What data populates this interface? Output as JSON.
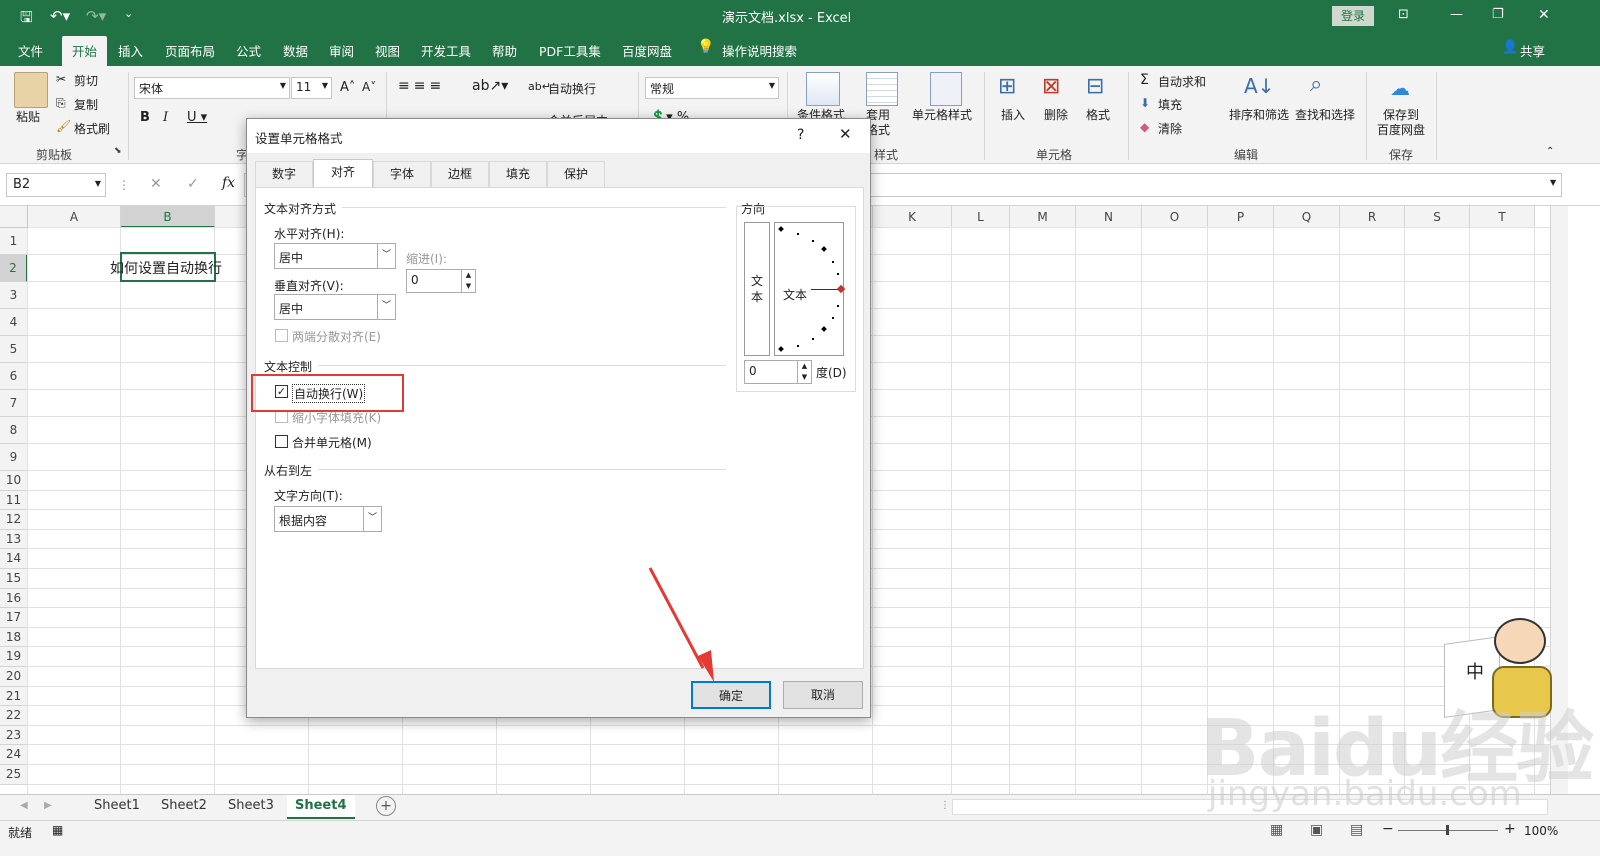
{
  "window": {
    "title": "演示文档.xlsx  -  Excel",
    "login": "登录",
    "share": "共享"
  },
  "ribbon_tabs": [
    "文件",
    "开始",
    "插入",
    "页面布局",
    "公式",
    "数据",
    "审阅",
    "视图",
    "开发工具",
    "帮助",
    "PDF工具集",
    "百度网盘",
    "操作说明搜索"
  ],
  "ribbon": {
    "paste": "粘贴",
    "cut": "剪切",
    "copy": "复制",
    "format_painter": "格式刷",
    "clipboard_group": "剪贴板",
    "font_name": "宋体",
    "font_size": "11",
    "font_group_partial": "字",
    "wrap_text": "自动换行",
    "merge_center": "合并后居中",
    "number_format": "常规",
    "conditional_format": "条件格式",
    "table_format_1": "套用",
    "table_format_2": "格式",
    "cell_styles": "单元格样式",
    "styles_group": "样式",
    "insert": "插入",
    "delete": "删除",
    "format": "格式",
    "cells_group": "单元格",
    "autosum": "自动求和",
    "fill": "填充",
    "clear": "清除",
    "sort_filter": "排序和筛选",
    "find_select": "查找和选择",
    "editing_group": "编辑",
    "save_to_1": "保存到",
    "save_to_2": "百度网盘",
    "save_group": "保存"
  },
  "formula_bar": {
    "name_box": "B2",
    "fx": "fx",
    "value": ""
  },
  "grid": {
    "columns": [
      "A",
      "B",
      "",
      "",
      "",
      "",
      "",
      "",
      "",
      "K",
      "L",
      "M",
      "N",
      "O",
      "P",
      "Q",
      "R",
      "S",
      "T"
    ],
    "rows": [
      "1",
      "2",
      "3",
      "4",
      "5",
      "6",
      "7",
      "8",
      "9",
      "10",
      "11",
      "12",
      "13",
      "14",
      "15",
      "16",
      "17",
      "18",
      "19",
      "20",
      "21",
      "22",
      "23",
      "24",
      "25"
    ],
    "cell_b2": "如何设置自动换行"
  },
  "sheets": [
    "Sheet1",
    "Sheet2",
    "Sheet3",
    "Sheet4"
  ],
  "active_sheet": "Sheet4",
  "status": {
    "ready": "就绪",
    "zoom": "100%"
  },
  "dialog": {
    "title": "设置单元格格式",
    "help": "?",
    "tabs": [
      "数字",
      "对齐",
      "字体",
      "边框",
      "填充",
      "保护"
    ],
    "active_tab": "对齐",
    "section_alignment": "文本对齐方式",
    "horizontal_label": "水平对齐(H):",
    "horizontal_value": "居中",
    "indent_label": "缩进(I):",
    "indent_value": "0",
    "vertical_label": "垂直对齐(V):",
    "vertical_value": "居中",
    "justify_distributed": "两端分散对齐(E)",
    "section_control": "文本控制",
    "wrap_text": "自动换行(W)",
    "wrap_checked": true,
    "shrink_to_fit": "缩小字体填充(K)",
    "merge_cells": "合并单元格(M)",
    "section_rtl": "从右到左",
    "direction_label": "文字方向(T):",
    "direction_value": "根据内容",
    "orientation_label": "方向",
    "orientation_vertical_text": "文本",
    "orientation_text": "文本",
    "degrees_value": "0",
    "degrees_label": "度(D)",
    "ok": "确定",
    "cancel": "取消"
  },
  "watermark": {
    "brand": "Baidu经验",
    "url": "jingyan.baidu.com",
    "sticker_text": "中"
  },
  "colors": {
    "excel_green": "#217346",
    "highlight_red": "#e53935",
    "ok_border": "#0078d7"
  }
}
